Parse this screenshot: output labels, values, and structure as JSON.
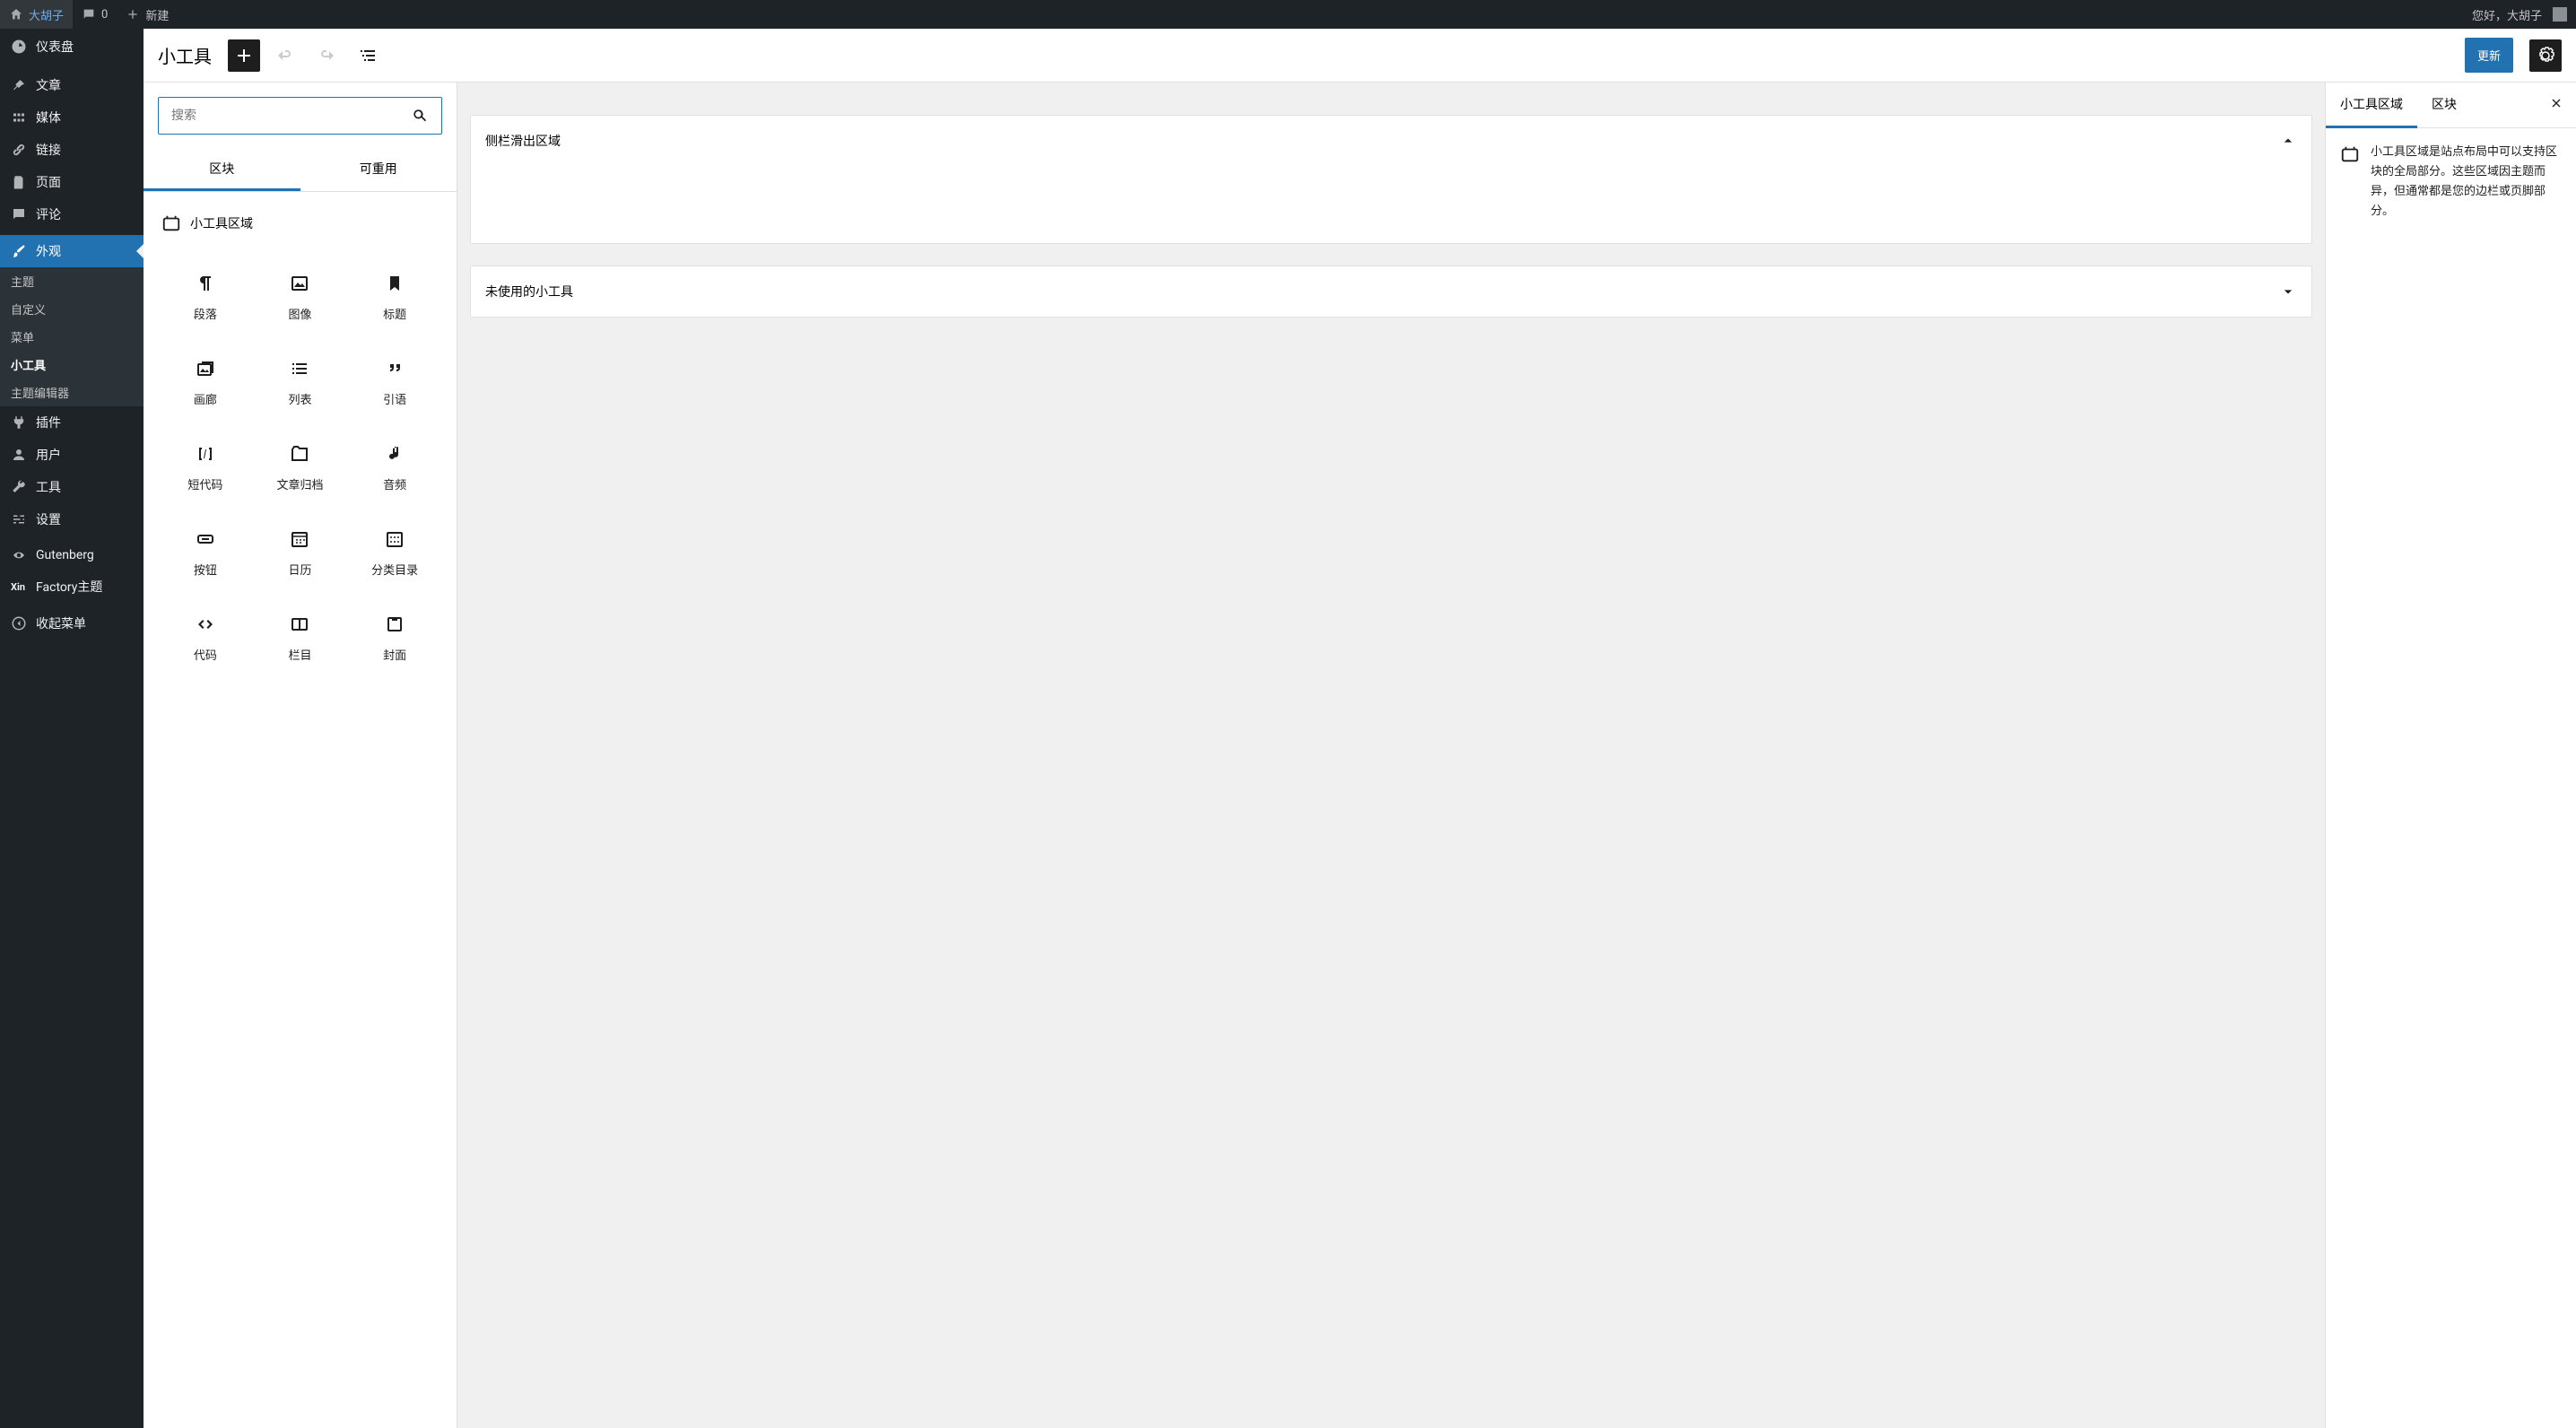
{
  "adminbar": {
    "site_name": "大胡子",
    "comments_count": "0",
    "new_label": "新建",
    "greeting": "您好，大胡子"
  },
  "sidebar": {
    "dashboard": "仪表盘",
    "posts": "文章",
    "media": "媒体",
    "links": "链接",
    "pages": "页面",
    "comments": "评论",
    "appearance": "外观",
    "sub_themes": "主题",
    "sub_customize": "自定义",
    "sub_menus": "菜单",
    "sub_widgets": "小工具",
    "sub_editor": "主题编辑器",
    "plugins": "插件",
    "users": "用户",
    "tools": "工具",
    "settings": "设置",
    "gutenberg": "Gutenberg",
    "factory": "Factory主题",
    "collapse": "收起菜单"
  },
  "topbar": {
    "title": "小工具",
    "update": "更新"
  },
  "inserter": {
    "search_placeholder": "搜索",
    "tab_blocks": "区块",
    "tab_reusable": "可重用",
    "category": "小工具区域",
    "blocks": {
      "0": "段落",
      "1": "图像",
      "2": "标题",
      "3": "画廊",
      "4": "列表",
      "5": "引语",
      "6": "短代码",
      "7": "文章归档",
      "8": "音频",
      "9": "按钮",
      "10": "日历",
      "11": "分类目录",
      "12": "代码",
      "13": "栏目",
      "14": "封面"
    }
  },
  "canvas": {
    "panel1_title": "侧栏滑出区域",
    "panel2_title": "未使用的小工具"
  },
  "rightbar": {
    "tab_area": "小工具区域",
    "tab_block": "区块",
    "desc": "小工具区域是站点布局中可以支持区块的全局部分。这些区域因主题而异，但通常都是您的边栏或页脚部分。"
  }
}
